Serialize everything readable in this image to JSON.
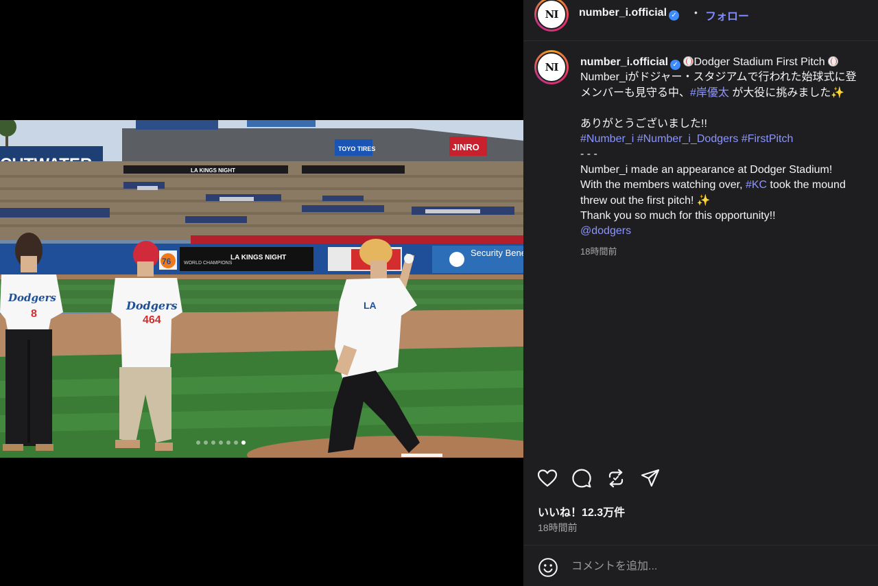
{
  "post": {
    "author": "number_i.official",
    "avatar_text": "NI",
    "follow_label": "フォロー",
    "separator": "•",
    "caption": {
      "line1": "Dodger Stadium First Pitch",
      "line2": "Number_iがドジャー・スタジアムで行われた始球式に登",
      "line3_pre": "メンバーも見守る中、",
      "line3_tag": "#岸優太",
      "line3_post": " が大役に挑みました",
      "line4": "ありがとうございました!!",
      "hashtags": [
        "#Number_i",
        "#Number_i_Dodgers",
        "#FirstPitch"
      ],
      "divider": "- - -",
      "line6": "Number_i made an appearance at Dodger Stadium!",
      "line7_pre": "With the members watching over, ",
      "line7_tag": "#KC",
      "line7_post": " took the mound",
      "line8": "threw out the first pitch! ",
      "line9": "Thank you so much for this opportunity!!",
      "mention": "@dodgers"
    },
    "caption_time": "18時間前",
    "likes": "いいね！12.3万件",
    "time": "18時間前",
    "comment_placeholder": "コメントを追加...",
    "carousel": {
      "total": 7,
      "active": 7
    }
  },
  "photo_signage": {
    "cutwater": "CUTWATER",
    "toyo": "TOYO TIRES",
    "jinro": "JINRO",
    "security": "Security Benefit",
    "la_kings": "LA KINGS NIGHT",
    "world": "WORLD CHAMPIONS",
    "seventy_six": "76",
    "jersey_left": "8",
    "jersey_mid": "464",
    "dodgers": "Dodgers",
    "la": "LA"
  },
  "colors": {
    "panel_bg": "#1e1e21",
    "link": "#8c95ff",
    "follow": "#7e8cff",
    "verified": "#3f8cff"
  }
}
